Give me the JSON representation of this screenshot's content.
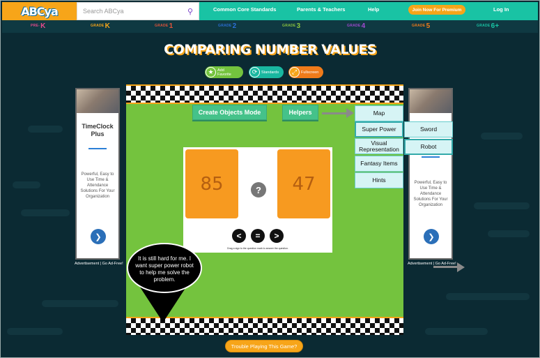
{
  "header": {
    "logo": "ABCya",
    "search_placeholder": "Search ABCya",
    "links": [
      "Common Core Standards",
      "Parents & Teachers",
      "Help"
    ],
    "premium": "Join Now For Premium",
    "login": "Log In"
  },
  "grades": [
    {
      "prefix": "PRE-",
      "big": "K",
      "color": "#e64a8c"
    },
    {
      "prefix": "GRADE",
      "big": "K",
      "color": "#f7a519"
    },
    {
      "prefix": "GRADE",
      "big": "1",
      "color": "#e0533a"
    },
    {
      "prefix": "GRADE",
      "big": "2",
      "color": "#2b6fd6"
    },
    {
      "prefix": "GRADE",
      "big": "3",
      "color": "#8bc43f"
    },
    {
      "prefix": "GRADE",
      "big": "4",
      "color": "#a24ad1"
    },
    {
      "prefix": "GRADE",
      "big": "5",
      "color": "#f07b1a"
    },
    {
      "prefix": "GRADE",
      "big": "6+",
      "color": "#19c3a4"
    }
  ],
  "page_title": "COMPARING NUMBER VALUES",
  "actions": {
    "favorite": "Add Favorite",
    "standards": "Standards",
    "fullscreen": "Fullscreen"
  },
  "ads": {
    "headline": "TimeClock Plus",
    "brand": "TimeClock Plus",
    "body": "Powerful, Easy to Use Time & Attendance Solutions For Your Organization",
    "note": "Advertisement | Go Ad-Free!"
  },
  "game": {
    "create_objects": "Create Objects Mode",
    "helpers": "Helpers",
    "menu": [
      "Map",
      "Super Power",
      "Visual Representation",
      "Fantasy Items",
      "Hints"
    ],
    "submenu": [
      "Sword",
      "Robot"
    ],
    "left_number": "85",
    "right_number": "47",
    "question_mark": "?",
    "signs": [
      "<",
      "=",
      ">"
    ],
    "instruction": "Drag a sign to the question mark to answer the question."
  },
  "bubble": "It is still hard for me. I want super power robot to help me solve the problem.",
  "trouble": "Trouble Playing This Game?"
}
